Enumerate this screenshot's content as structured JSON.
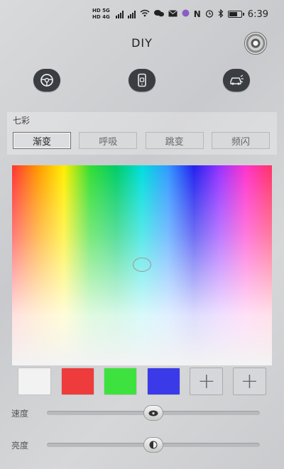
{
  "status_bar": {
    "network_top": "HD 5G",
    "network_bottom": "HD 4G",
    "time": "6:39"
  },
  "header": {
    "title": "DIY",
    "icons": [
      "disc-icon"
    ]
  },
  "toolbar": {
    "buttons": [
      {
        "icon": "steering-wheel-icon"
      },
      {
        "icon": "phone-car-icon"
      },
      {
        "icon": "car-horn-icon"
      }
    ]
  },
  "mode_panel": {
    "label": "七彩",
    "tabs": [
      "渐变",
      "呼吸",
      "跳变",
      "频闪"
    ],
    "selected": 0
  },
  "swatches": [
    {
      "color": "#f2f2f2"
    },
    {
      "color": "#ee3b3b"
    },
    {
      "color": "#3ee23e"
    },
    {
      "color": "#3a3ae8"
    },
    {
      "add_label": "+"
    },
    {
      "add_label": "+"
    }
  ],
  "sliders": {
    "speed": {
      "label": "速度",
      "value": 0.5
    },
    "brightness": {
      "label": "亮度",
      "value": 0.5
    }
  }
}
